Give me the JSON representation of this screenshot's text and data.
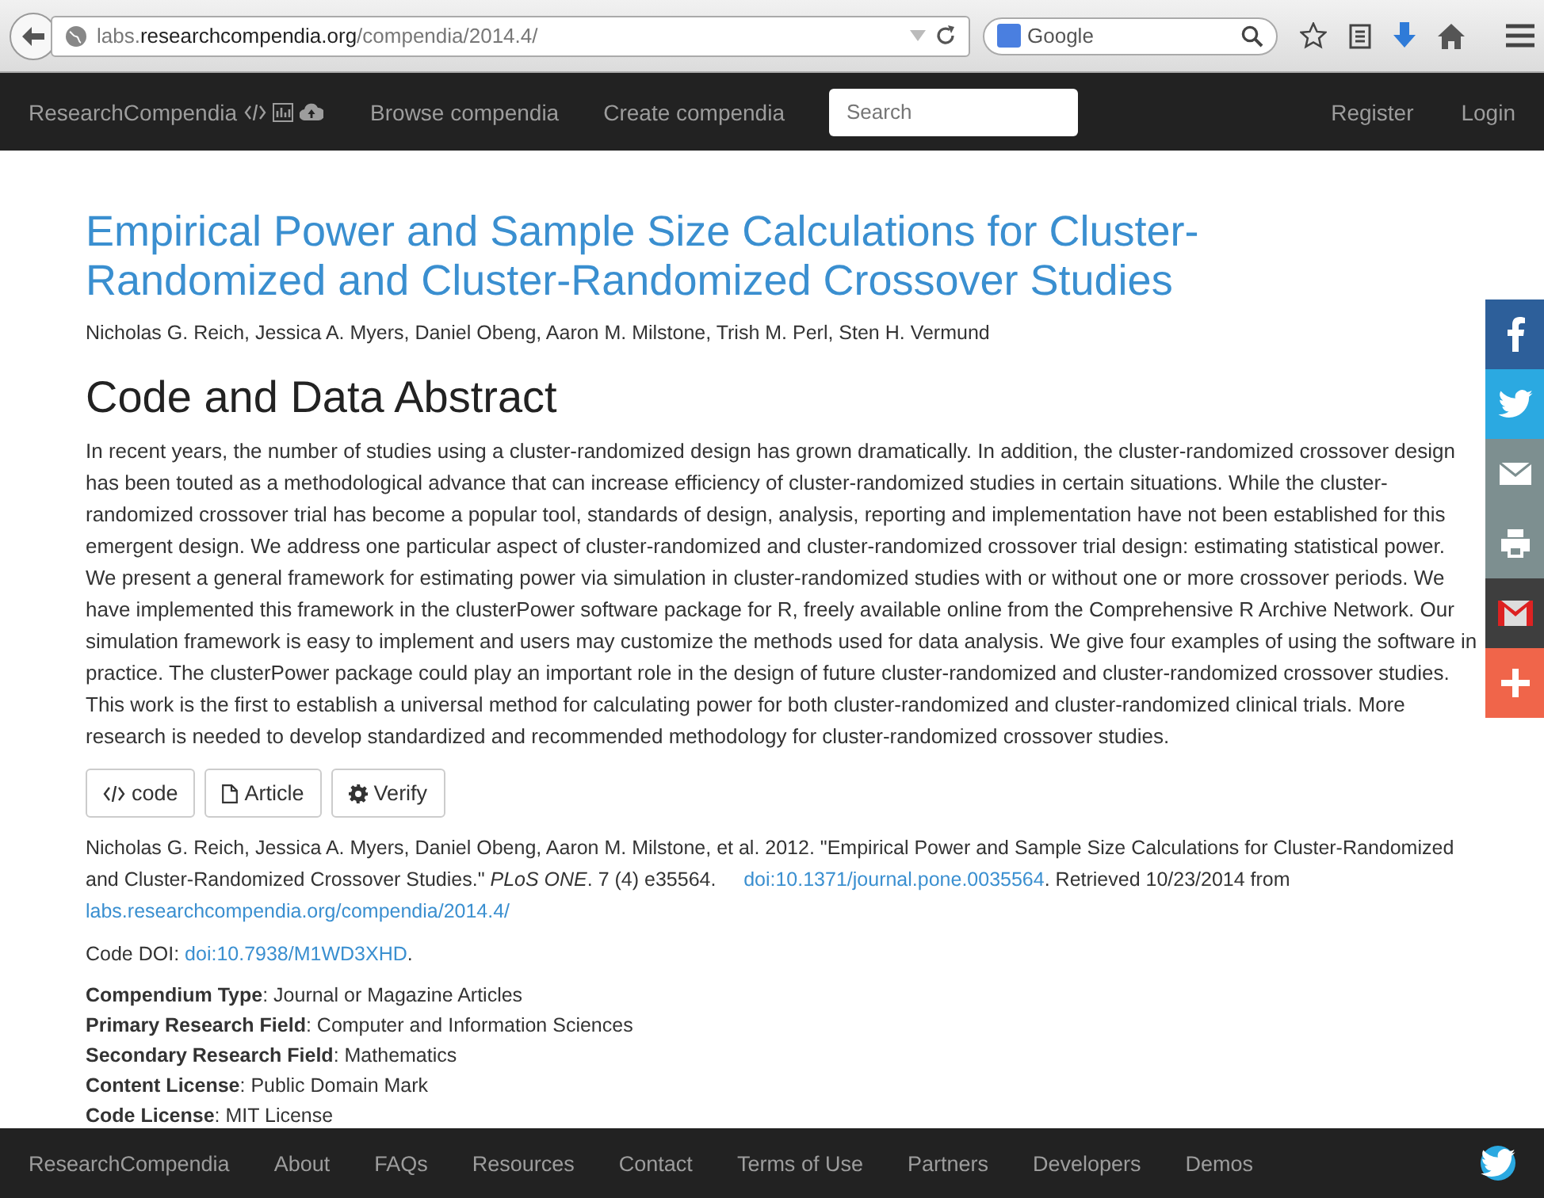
{
  "browser": {
    "url": "labs.**researchcompendia.org**/compendia/2014.4/",
    "search_engine": "Google"
  },
  "nav": {
    "brand": "ResearchCompendia",
    "links": [
      "Browse compendia",
      "Create compendia"
    ],
    "search": {
      "placeholder": "Search"
    },
    "right_links": [
      "Register",
      "Login"
    ]
  },
  "article": {
    "title": "Empirical Power and Sample Size Calculations for Cluster-Randomized and Cluster-Randomized Crossover Studies",
    "authors": "Nicholas G. Reich, Jessica A. Myers, Daniel Obeng, Aaron M. Milstone, Trish M. Perl, Sten H. Vermund",
    "heading": "Code and Data Abstract",
    "abstract": "In recent years, the number of studies using a cluster-randomized design has grown dramatically. In addition, the cluster-randomized crossover design has been touted as a methodological advance that can increase efficiency of cluster-randomized studies in certain situations. While the cluster-randomized crossover trial has become a popular tool, standards of design, analysis, reporting and implementation have not been established for this emergent design. We address one particular aspect of cluster-randomized and cluster-randomized crossover trial design: estimating statistical power. We present a general framework for estimating power via simulation in cluster-randomized studies with or without one or more crossover periods. We have implemented this framework in the clusterPower software package for R, freely available online from the Comprehensive R Archive Network. Our simulation framework is easy to implement and users may customize the methods used for data analysis. We give four examples of using the software in practice. The clusterPower package could play an important role in the design of future cluster-randomized and cluster-randomized crossover studies. This work is the first to establish a universal method for calculating power for both cluster-randomized and cluster-randomized clinical trials. More research is needed to develop standardized and recommended methodology for cluster-randomized crossover studies.",
    "buttons": [
      {
        "label": "code",
        "kind": "code"
      },
      {
        "label": "Article",
        "kind": "file"
      },
      {
        "label": "Verify",
        "kind": "gear"
      }
    ],
    "citation": {
      "text": "Nicholas G. Reich, Jessica A. Myers, Daniel Obeng, Aaron M. Milstone, et al. 2012. \"Empirical Power and Sample Size Calculations for Cluster-Randomized and Cluster-Randomized Crossover Studies.\" *PLoS ONE*. 7 (4) e35564.",
      "doi": "doi:10.1371/journal.pone.0035564",
      "retrieved": ". Retrieved 10/23/2014 from",
      "url": "labs.researchcompendia.org/compendia/2014.4/"
    },
    "code_doi": {
      "label": "Code DOI:",
      "link": "doi:10.7938/M1WD3XHD",
      "suffix": "."
    },
    "metadata": [
      {
        "label": "Compendium Type",
        "value": ": Journal or Magazine Articles"
      },
      {
        "label": "Primary Research Field",
        "value": ": Computer and Information Sciences"
      },
      {
        "label": "Secondary Research Field",
        "value": ": Mathematics"
      },
      {
        "label": "Content License",
        "value": ": Public Domain Mark"
      },
      {
        "label": "Code License",
        "value": ": MIT License"
      }
    ]
  },
  "social": [
    {
      "kind": "facebook",
      "color": "#2d5f9a"
    },
    {
      "kind": "twitter",
      "color": "#2ba9e1"
    },
    {
      "kind": "email",
      "color": "#7d8f90"
    },
    {
      "kind": "print",
      "color": "#7d8f90"
    },
    {
      "kind": "gmail",
      "color": "#3e3e3e"
    },
    {
      "kind": "plus",
      "color": "#f0654a"
    }
  ],
  "footer": {
    "links": [
      "ResearchCompendia",
      "About",
      "FAQs",
      "Resources",
      "Contact",
      "Terms of Use",
      "Partners",
      "Developers",
      "Demos"
    ]
  }
}
